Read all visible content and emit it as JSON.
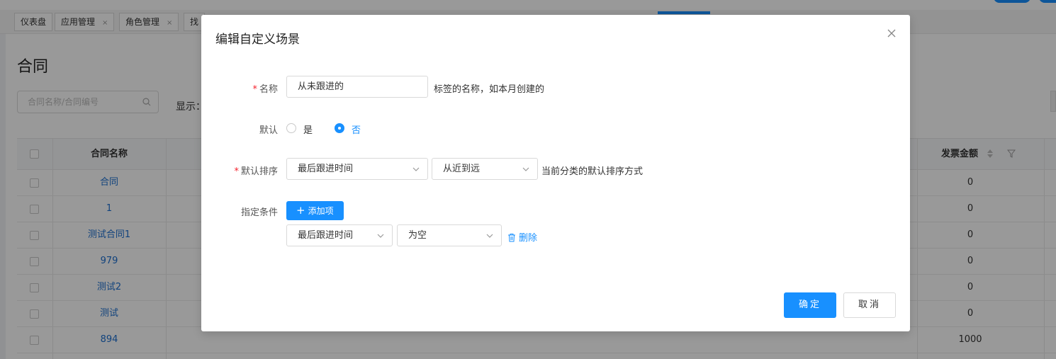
{
  "tabs": [
    {
      "label": "仪表盘",
      "closable": false
    },
    {
      "label": "应用管理",
      "closable": true
    },
    {
      "label": "角色管理",
      "closable": true
    },
    {
      "label": "找",
      "closable": false
    }
  ],
  "tab_close_glyph": "×",
  "page": {
    "title": "合同",
    "search_placeholder": "合同名称/合同编号",
    "show_label": "显示："
  },
  "table": {
    "col_name": "合同名称",
    "col_amount": "发票金额",
    "rows": [
      {
        "name": "合同",
        "amount": "0"
      },
      {
        "name": "1",
        "amount": "0"
      },
      {
        "name": "测试合同1",
        "amount": "0"
      },
      {
        "name": "979",
        "amount": "0"
      },
      {
        "name": "测试2",
        "amount": "0"
      },
      {
        "name": "测试",
        "amount": "0"
      },
      {
        "name": "894",
        "amount": "1000"
      }
    ]
  },
  "modal": {
    "title": "编辑自定义场景",
    "name_label": "名称",
    "name_value": "从未跟进的",
    "name_hint": "标签的名称，如本月创建的",
    "default_label": "默认",
    "default_yes": "是",
    "default_no": "否",
    "default_selected": "否",
    "sort_label": "默认排序",
    "sort_field": "最后跟进时间",
    "sort_order": "从近到远",
    "sort_hint": "当前分类的默认排序方式",
    "cond_label": "指定条件",
    "add_button": "添加项",
    "cond_field": "最后跟进时间",
    "cond_op": "为空",
    "delete_link": "删除",
    "ok_button": "确定",
    "cancel_button": "取消",
    "required_mark": "*"
  },
  "colors": {
    "primary": "#1890ff",
    "link": "#1c6fd0",
    "required": "#f5222d"
  }
}
